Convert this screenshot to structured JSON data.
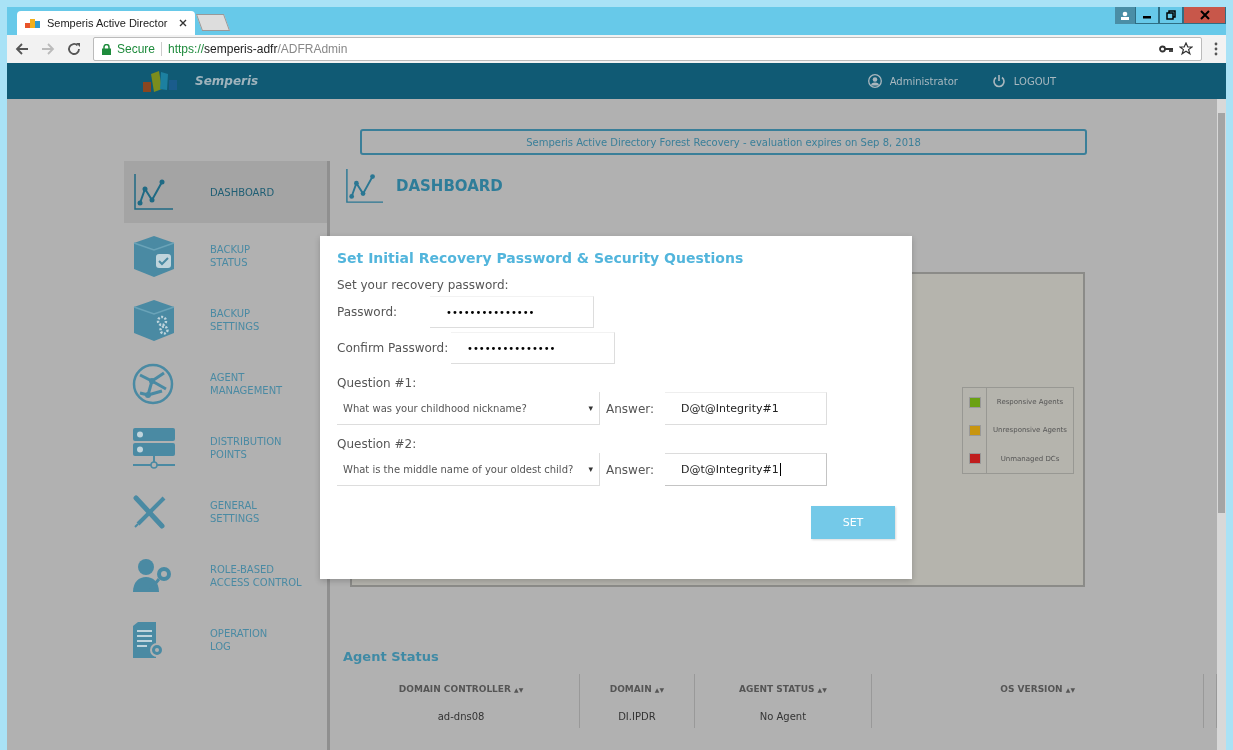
{
  "browser": {
    "tab_title": "Semperis Active Director",
    "secure_label": "Secure",
    "url_scheme": "https://",
    "url_host": "semperis-adfr",
    "url_path": "/ADFRAdmin"
  },
  "header": {
    "brand": "Semperis",
    "user": "Administrator",
    "logout": "LOGOUT"
  },
  "banner": "Semperis Active Directory Forest Recovery - evaluation expires on Sep 8, 2018",
  "sidebar": {
    "items": [
      {
        "kind": "chart",
        "label": [
          "DASHBOARD"
        ],
        "selected": true
      },
      {
        "kind": "box-check",
        "label": [
          "BACKUP",
          "STATUS"
        ],
        "selected": false
      },
      {
        "kind": "box-gear",
        "label": [
          "BACKUP",
          "SETTINGS"
        ],
        "selected": false
      },
      {
        "kind": "globe",
        "label": [
          "AGENT",
          "MANAGEMENT"
        ],
        "selected": false
      },
      {
        "kind": "server",
        "label": [
          "DISTRIBUTION",
          "POINTS"
        ],
        "selected": false
      },
      {
        "kind": "tools",
        "label": [
          "GENERAL",
          "SETTINGS"
        ],
        "selected": false
      },
      {
        "kind": "user-key",
        "label": [
          "ROLE-BASED",
          "ACCESS CONTROL"
        ],
        "selected": false
      },
      {
        "kind": "doc-gear",
        "label": [
          "OPERATION",
          "LOG"
        ],
        "selected": false
      }
    ]
  },
  "page_title": "DASHBOARD",
  "legend": [
    {
      "label": "Responsive Agents",
      "color": "#6aa112"
    },
    {
      "label": "Unresponsive Agents",
      "color": "#c8950f"
    },
    {
      "label": "Unmanaged DCs",
      "color": "#c01e1e"
    }
  ],
  "agent_status": {
    "title": "Agent Status",
    "columns": [
      "DOMAIN CONTROLLER",
      "DOMAIN",
      "AGENT STATUS",
      "OS VERSION"
    ],
    "sort_icon": "▲▼",
    "rows": [
      [
        "ad-dns08",
        "DI.IPDR",
        "No Agent"
      ]
    ]
  },
  "dialog": {
    "title": "Set Initial Recovery Password & Security Questions",
    "intro": "Set your recovery password:",
    "password_label": "Password:",
    "password_value": "•••••••••••••••",
    "confirm_label": "Confirm Password:",
    "confirm_value": "•••••••••••••••",
    "questions": [
      {
        "label": "Question #1:",
        "question": "What was your childhood nickname?",
        "answer_label": "Answer:",
        "answer": "D@t@Integrity#1",
        "focused": false
      },
      {
        "label": "Question #2:",
        "question": "What is the middle name of your oldest child?",
        "answer_label": "Answer:",
        "answer": "D@t@Integrity#1",
        "focused": true
      }
    ],
    "dropdown_caret": "▾",
    "submit": "SET"
  }
}
